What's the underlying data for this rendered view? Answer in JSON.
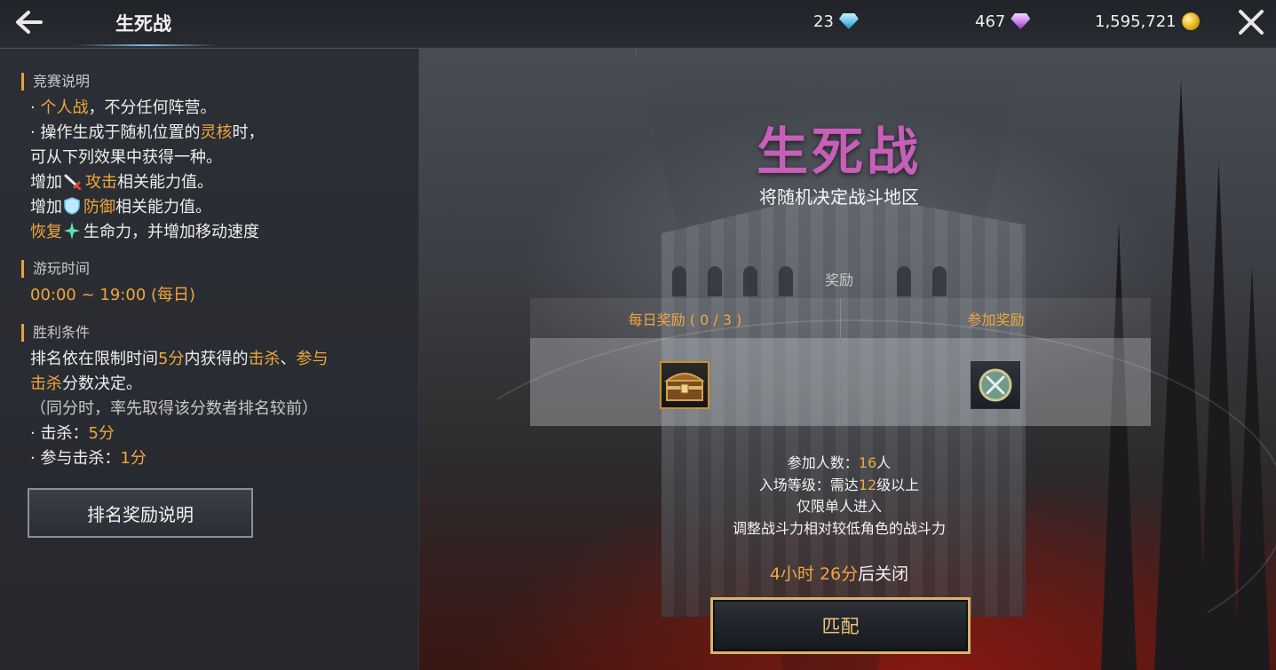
{
  "header": {
    "title": "生死战",
    "currency": [
      {
        "value": "23",
        "icon": "blue-diamond-icon",
        "color": "#7fd3ff"
      },
      {
        "value": "467",
        "icon": "purple-diamond-icon",
        "color": "#d08cf5"
      },
      {
        "value": "1,595,721",
        "icon": "gold-coin-icon",
        "color": "#e8b923"
      }
    ]
  },
  "sidebar": {
    "rules": {
      "heading": "竞赛说明",
      "l1_bullet": "· ",
      "l1_hl": "个人战",
      "l1_rest": "，不分任何阵营。",
      "l2_prefix": "· 操作生成于随机位置的",
      "l2_hl": "灵核",
      "l2_rest": "时，",
      "l3": "可从下列效果中获得一种。",
      "l4_prefix": "增加",
      "l4_hl": "攻击",
      "l4_rest": "相关能力值。",
      "l5_prefix": "增加",
      "l5_hl": "防御",
      "l5_rest": "相关能力值。",
      "l6_hl": "恢复",
      "l6_rest": "生命力，并增加移动速度"
    },
    "playtime": {
      "heading": "游玩时间",
      "value": "00:00 ~ 19:00 (每日)"
    },
    "victory": {
      "heading": "胜利条件",
      "l1_a": "排名依在限制时间",
      "l1_b": "5分",
      "l1_c": "内获得的",
      "l1_d": "击杀",
      "l1_e": "、",
      "l1_f": "参与",
      "l2_a": "击杀",
      "l2_b": "分数决定。",
      "l3": "（同分时，率先取得该分数者排名较前）",
      "l4_a": "· 击杀：",
      "l4_b": "5分",
      "l5_a": "· 参与击杀：",
      "l5_b": "1分"
    },
    "rank_button": "排名奖励说明"
  },
  "main": {
    "mode_title": "生死战",
    "subtitle": "将随机决定战斗地区",
    "reward_label": "奖励",
    "rewards": [
      {
        "label": "每日奖励 ( 0 / 3 )",
        "icon": "treasure-chest-icon"
      },
      {
        "label": "参加奖励",
        "icon": "crossed-swords-medal-icon"
      }
    ],
    "info": {
      "participants_a": "参加人数：",
      "participants_b": "16",
      "participants_c": "人",
      "level_a": "入场等级：需达",
      "level_b": "12",
      "level_c": "级以上",
      "solo": "仅限单人进入",
      "adjust": "调整战斗力相对较低角色的战斗力"
    },
    "close_time_a": "4小时 26分",
    "close_time_b": "后关闭",
    "match_button": "匹配"
  }
}
